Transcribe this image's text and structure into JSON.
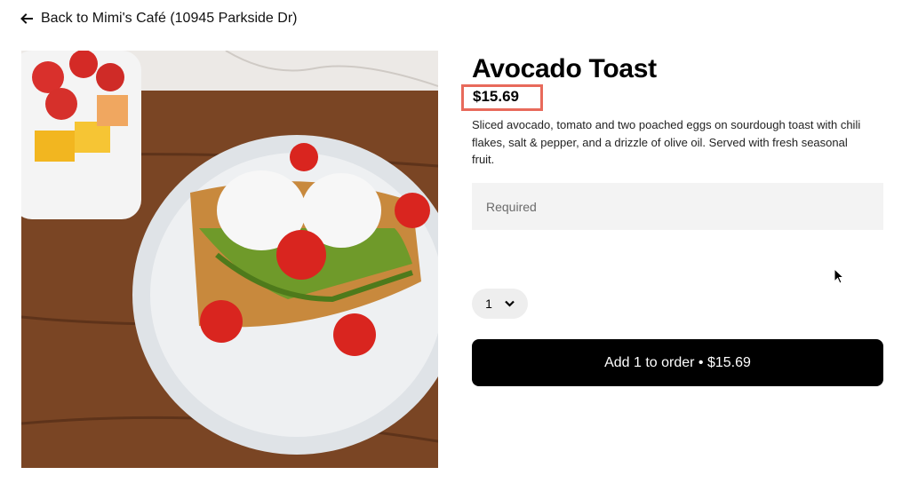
{
  "nav": {
    "back_label": "Back to Mimi's Café (10945 Parkside Dr)",
    "back_icon": "arrow-left-icon"
  },
  "item": {
    "title": "Avocado Toast",
    "price": "$15.69",
    "description": "Sliced avocado, tomato and two poached eggs on sourdough toast with chili flakes, salt & pepper, and a drizzle of olive oil. Served with fresh seasonal fruit.",
    "image_alt": "Avocado Toast"
  },
  "options": {
    "required_label": "Required"
  },
  "quantity": {
    "value": "1",
    "icon": "chevron-down-icon"
  },
  "cart": {
    "add_label": "Add 1 to order • $15.69"
  },
  "colors": {
    "highlight": "#e86a5b",
    "button_bg": "#000000",
    "input_bg": "#f3f3f3"
  }
}
